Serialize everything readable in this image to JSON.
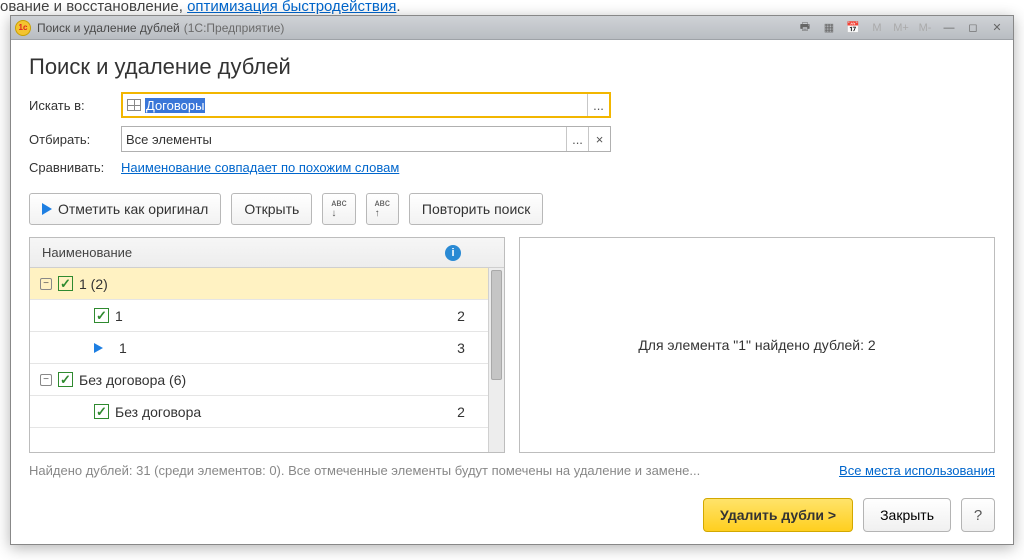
{
  "background_text_pre": "ование и восстановление, ",
  "background_text_link": "оптимизация быстродействия",
  "window": {
    "title": "Поиск и удаление дублей",
    "subtitle": "(1С:Предприятие)"
  },
  "page": {
    "title": "Поиск и удаление дублей"
  },
  "fields": {
    "search_in_label": "Искать в:",
    "search_in_value": "Договоры",
    "filter_label": "Отбирать:",
    "filter_value": "Все элементы",
    "compare_label": "Сравнивать:",
    "compare_value": "Наименование совпадает по похожим словам"
  },
  "toolbar": {
    "mark_original": "Отметить как оригинал",
    "open": "Открыть",
    "repeat_search": "Повторить поиск"
  },
  "grid": {
    "header_name": "Наименование",
    "rows": [
      {
        "type": "group",
        "label": "1 (2)",
        "selected": true
      },
      {
        "type": "child_check",
        "label": "1",
        "col2": "2"
      },
      {
        "type": "child_arrow",
        "label": "1",
        "col2": "3"
      },
      {
        "type": "group",
        "label": "Без договора (6)",
        "selected": false
      },
      {
        "type": "child_check",
        "label": "Без договора",
        "col2": "2"
      }
    ]
  },
  "right_panel": "Для элемента \"1\" найдено дублей: 2",
  "status_text": "Найдено дублей: 31 (среди элементов: 0). Все отмеченные элементы будут помечены на удаление и замене...",
  "status_link": "Все места использования",
  "footer": {
    "delete": "Удалить дубли >",
    "close": "Закрыть",
    "help": "?"
  },
  "misc": {
    "ellipsis": "...",
    "cross": "×",
    "minus": "−"
  }
}
